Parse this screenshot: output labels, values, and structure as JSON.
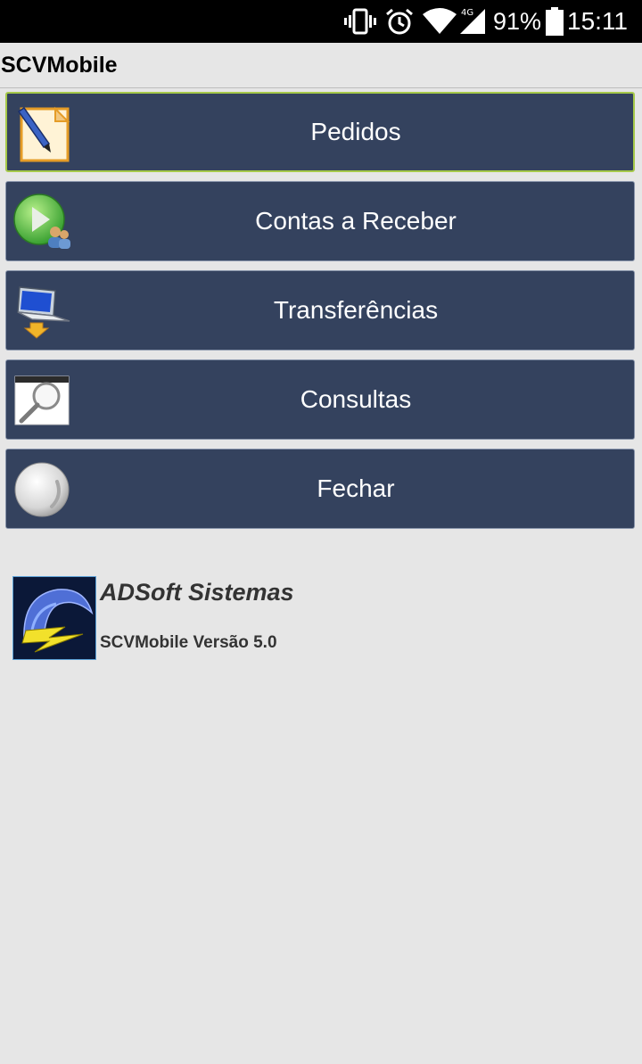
{
  "status_bar": {
    "network_type": "4G",
    "battery_percent": "91%",
    "time": "15:11",
    "icons": [
      "vibrate-icon",
      "alarm-icon",
      "wifi-icon",
      "cellular-signal-icon",
      "battery-icon"
    ]
  },
  "app": {
    "title": "SCVMobile"
  },
  "menu": {
    "items": [
      {
        "label": "Pedidos",
        "icon": "notepad-pen-icon",
        "active": true
      },
      {
        "label": "Contas a Receber",
        "icon": "receivables-users-icon",
        "active": false
      },
      {
        "label": "Transferências",
        "icon": "laptop-transfer-icon",
        "active": false
      },
      {
        "label": "Consultas",
        "icon": "magnifier-icon",
        "active": false
      },
      {
        "label": "Fechar",
        "icon": "close-sphere-icon",
        "active": false
      }
    ]
  },
  "brand": {
    "company": "ADSoft Sistemas",
    "version": "SCVMobile Versão 5.0",
    "logo_icon": "adsoft-logo-icon"
  },
  "colors": {
    "background": "#e6e6e6",
    "button_bg": "#34425e",
    "active_border": "#a6c94a",
    "status_bar": "#000000"
  }
}
